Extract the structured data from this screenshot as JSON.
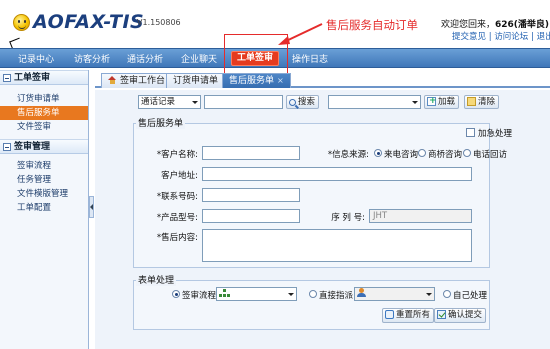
{
  "header": {
    "logo": "AOFAX-TIS",
    "version": "V1.150806",
    "welcome_prefix": "欢迎您回来，",
    "user": "626(潘举良)",
    "links": [
      "提交意见",
      "访问论坛",
      "退出"
    ]
  },
  "nav": {
    "items": [
      "记录中心",
      "访客分析",
      "通话分析",
      "企业聊天",
      "工单签审",
      "操作日志"
    ],
    "active_index": 4
  },
  "annotation": {
    "text": "售后服务自动订单",
    "color": "#e52b2b"
  },
  "sidebar": {
    "sections": [
      {
        "title": "工单签审",
        "items": [
          "订货申请单",
          "售后服务单",
          "文件签审"
        ],
        "active_index": 1
      },
      {
        "title": "签审管理",
        "items": [
          "签审流程",
          "任务管理",
          "文件模版管理",
          "工单配置"
        ]
      }
    ]
  },
  "tabs": [
    {
      "label": "签审工作台",
      "icon": "home-icon"
    },
    {
      "label": "订货申请单"
    },
    {
      "label": "售后服务单",
      "active": true
    }
  ],
  "search": {
    "type_value": "通话记录",
    "keyword": "",
    "search_label": "搜索",
    "filter_value": "",
    "load_label": "加载",
    "clear_label": "清除"
  },
  "service_form": {
    "legend": "售后服务单",
    "urgent_label": "加急处理",
    "customer_name_label": "*客户名称:",
    "customer_name": "",
    "source_label": "*信息来源:",
    "sources": [
      "来电咨询",
      "商桥咨询",
      "电话回访"
    ],
    "source_selected_index": 0,
    "address_label": "客户地址:",
    "address": "",
    "phone_label": "*联系号码:",
    "phone": "",
    "model_label": "*产品型号:",
    "model": "",
    "serial_label": "序 列 号:",
    "serial": "JHT",
    "content_label": "*售后内容:",
    "content": ""
  },
  "process": {
    "legend": "表单处理",
    "options": [
      "签审流程",
      "直接指派",
      "自己处理"
    ],
    "selected_index": 0,
    "flow_value": "",
    "assign_value": "",
    "reset_label": "重置所有",
    "submit_label": "确认提交"
  }
}
